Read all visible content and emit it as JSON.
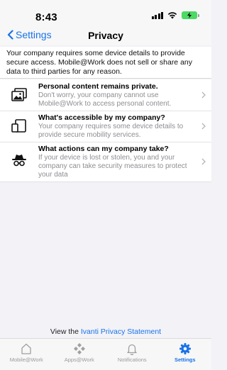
{
  "status_bar": {
    "time": "8:43"
  },
  "nav": {
    "back_label": "Settings",
    "title": "Privacy"
  },
  "intro_text": "Your company requires some device details to provide secure access. Mobile@Work does not sell or share any data to third parties for any reason.",
  "rows": [
    {
      "icon": "photos-icon",
      "title": "Personal content remains private.",
      "desc": "Don't worry, your company cannot use Mobile@Work to access personal content."
    },
    {
      "icon": "devices-icon",
      "title": "What's accessible by my company?",
      "desc": "Your company requires some device details to provide secure mobility services."
    },
    {
      "icon": "incognito-icon",
      "title": "What actions can my company take?",
      "desc": "If your device is lost or stolen, you and your company can take security measures to protect your data"
    }
  ],
  "footer": {
    "prefix": "View the ",
    "link": "Ivanti Privacy Statement"
  },
  "tabs": [
    {
      "label": "Mobile@Work",
      "icon": "home-icon",
      "active": false
    },
    {
      "label": "Apps@Work",
      "icon": "apps-icon",
      "active": false
    },
    {
      "label": "Notifications",
      "icon": "bell-icon",
      "active": false
    },
    {
      "label": "Settings",
      "icon": "gear-icon",
      "active": true
    }
  ],
  "colors": {
    "accent": "#1a73e8",
    "battery": "#4cd964"
  }
}
